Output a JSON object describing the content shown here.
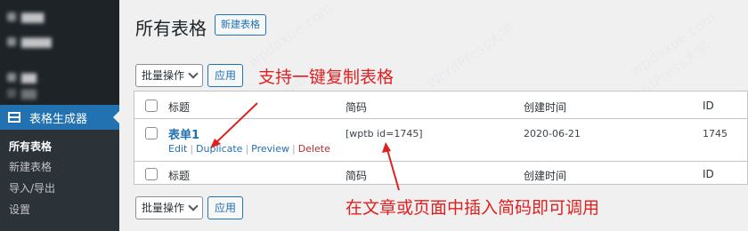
{
  "sidebar": {
    "active_menu": "表格生成器",
    "submenu": [
      "所有表格",
      "新建表格",
      "导入/导出",
      "设置"
    ]
  },
  "header": {
    "title": "所有表格",
    "add_new_label": "新建表格"
  },
  "bulk_actions": {
    "select_label": "批量操作",
    "apply_label": "应用"
  },
  "table": {
    "columns": [
      "标题",
      "简码",
      "创建时间",
      "ID"
    ],
    "rows": [
      {
        "title": "表单1",
        "shortcode": "[wptb id=1745]",
        "created": "2020-06-21",
        "id": "1745",
        "actions": [
          "Edit",
          "Duplicate",
          "Preview",
          "Delete"
        ]
      }
    ]
  },
  "annotations": {
    "top": "支持一键复制表格",
    "bottom": "在文章或页面中插入简码即可调用",
    "color": "#e02020"
  },
  "colors": {
    "accent": "#2271b1",
    "sidebar_bg": "#1d2327",
    "delete": "#b32d2e"
  }
}
